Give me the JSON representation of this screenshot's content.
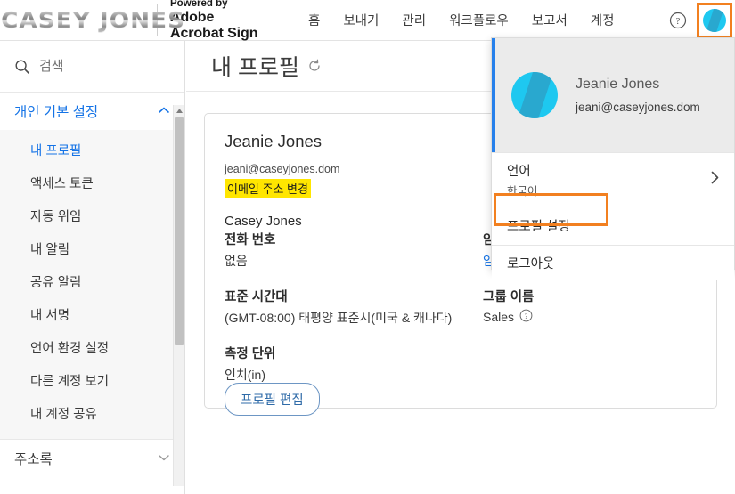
{
  "header": {
    "logo_text": "CASEY JONES",
    "powered_by": "Powered by",
    "brand_line1": "Adobe",
    "brand_line2": "Acrobat Sign",
    "nav": [
      {
        "label": "홈",
        "name": "nav-home"
      },
      {
        "label": "보내기",
        "name": "nav-send"
      },
      {
        "label": "관리",
        "name": "nav-manage"
      },
      {
        "label": "워크플로우",
        "name": "nav-workflow"
      },
      {
        "label": "보고서",
        "name": "nav-reports"
      },
      {
        "label": "계정",
        "name": "nav-account"
      }
    ],
    "help_icon": "question-mark-circle-icon",
    "avatar_icon": "user-avatar-icon"
  },
  "sidebar": {
    "search_placeholder": "검색",
    "search_value": "",
    "search_icon": "search-icon",
    "sections": [
      {
        "label": "개인 기본 설정",
        "expanded": true,
        "chevron": "chevron-up-icon",
        "items": [
          {
            "label": "내 프로필",
            "active": true
          },
          {
            "label": "액세스 토큰",
            "active": false
          },
          {
            "label": "자동 위임",
            "active": false
          },
          {
            "label": "내 알림",
            "active": false
          },
          {
            "label": "공유 알림",
            "active": false
          },
          {
            "label": "내 서명",
            "active": false
          },
          {
            "label": "언어 환경 설정",
            "active": false
          },
          {
            "label": "다른 계정 보기",
            "active": false
          },
          {
            "label": "내 계정 공유",
            "active": false
          }
        ]
      },
      {
        "label": "주소록",
        "expanded": false,
        "chevron": "chevron-down-icon",
        "items": []
      }
    ]
  },
  "main": {
    "page_title": "내 프로필",
    "refresh_icon": "refresh-icon",
    "profile": {
      "name": "Jeanie Jones",
      "email": "jeani@caseyjones.dom",
      "change_email_link": "이메일 주소 변경",
      "company": "Casey Jones"
    },
    "fields_left": [
      {
        "label": "전화 번호",
        "value": "없음",
        "type": "text"
      },
      {
        "label": "표준 시간대",
        "value": "(GMT-08:00) 태평양 표준시(미국 & 캐나다)",
        "type": "text"
      },
      {
        "label": "측정 단위",
        "value": "인치(in)",
        "type": "text"
      }
    ],
    "fields_right": [
      {
        "label": "암호",
        "value": "암호 변경",
        "type": "link"
      },
      {
        "label": "그룹 이름",
        "value": "Sales",
        "type": "text",
        "info_icon": "info-circle-icon"
      }
    ],
    "edit_button": "프로필 편집"
  },
  "dropdown": {
    "user_name": "Jeanie Jones",
    "user_email": "jeani@caseyjones.dom",
    "avatar_icon": "user-avatar-icon",
    "items": [
      {
        "label": "언어",
        "sub": "한국어",
        "chevron": "chevron-right-icon",
        "highlighted": false
      },
      {
        "label": "프로필 설정",
        "sub": "",
        "chevron": "",
        "highlighted": true
      },
      {
        "label": "로그아웃",
        "sub": "",
        "chevron": "",
        "highlighted": false
      }
    ]
  },
  "colors": {
    "accent_blue": "#1473e6",
    "highlight_orange": "#f28020",
    "highlight_yellow": "#ffe600",
    "avatar_cyan": "#1ec8f0"
  }
}
